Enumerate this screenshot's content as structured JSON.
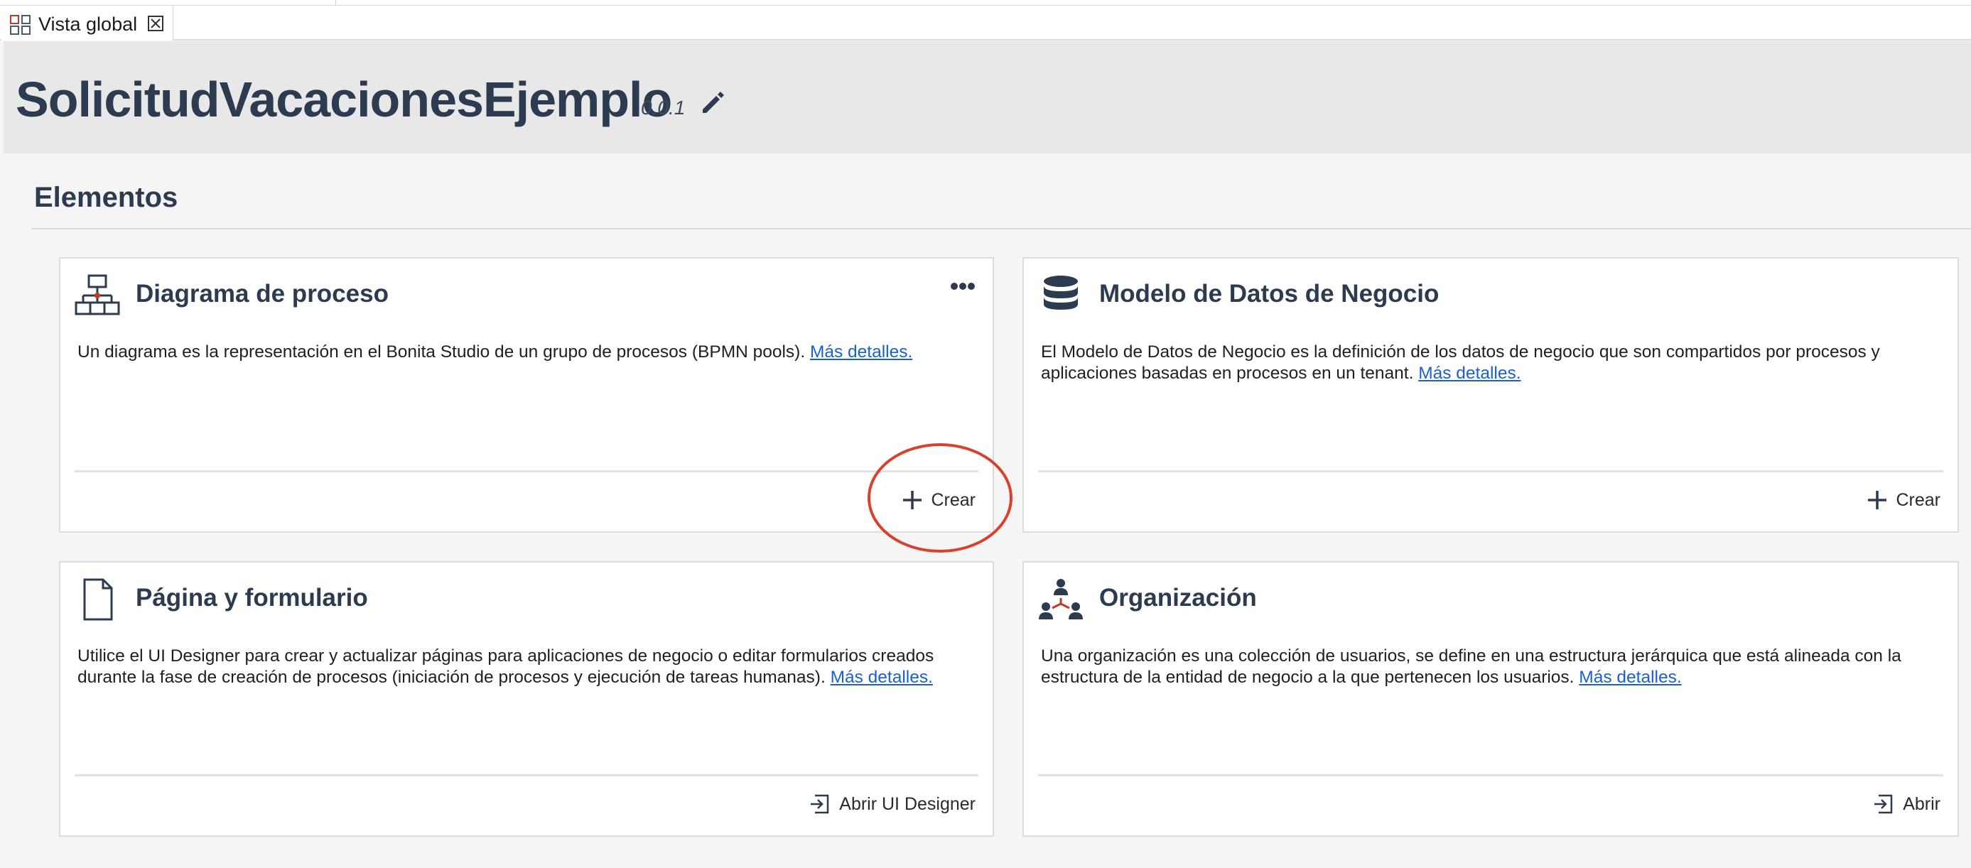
{
  "tab": {
    "label": "Vista global",
    "icon": "overview-grid-icon",
    "close_icon": "close-icon"
  },
  "header": {
    "project_name": "SolicitudVacacionesEjemplo",
    "version": "0.0.1",
    "edit_icon": "pencil-icon"
  },
  "section": {
    "title": "Elementos"
  },
  "cards": {
    "process_diagram": {
      "icon": "process-diagram-icon",
      "title": "Diagrama de proceso",
      "description": "Un diagrama es la representación en el Bonita Studio de un grupo de procesos (BPMN pools). ",
      "link": "Más detalles.",
      "action_label": "Crear",
      "action_icon": "plus-icon",
      "more_icon": "more-horizontal-icon"
    },
    "business_data": {
      "icon": "database-icon",
      "title": "Modelo de Datos de Negocio",
      "description": "El Modelo de Datos de Negocio es la definición de los datos de negocio que son compartidos por procesos y aplicaciones basadas en procesos en un tenant. ",
      "link": "Más detalles.",
      "action_label": "Crear",
      "action_icon": "plus-icon"
    },
    "pages_forms": {
      "icon": "page-icon",
      "title": "Página y formulario",
      "description": "Utilice el UI Designer para crear y actualizar páginas para aplicaciones de negocio o editar formularios creados durante la fase de creación de procesos (iniciación de procesos y ejecución de tareas humanas). ",
      "link": "Más detalles.",
      "action_label": "Abrir UI Designer",
      "action_icon": "open-external-icon"
    },
    "organization": {
      "icon": "organization-icon",
      "title": "Organización",
      "description": "Una organización es una colección de usuarios, se define en una estructura jerárquica que está alineada con la estructura de la entidad de negocio a la que pertenecen los usuarios. ",
      "link": "Más detalles.",
      "action_label": "Abrir",
      "action_icon": "open-external-icon"
    }
  },
  "colors": {
    "primary_text": "#2d3b50",
    "link": "#1a5fd6",
    "highlight": "#d9412f",
    "accent_red": "#c0392b"
  }
}
